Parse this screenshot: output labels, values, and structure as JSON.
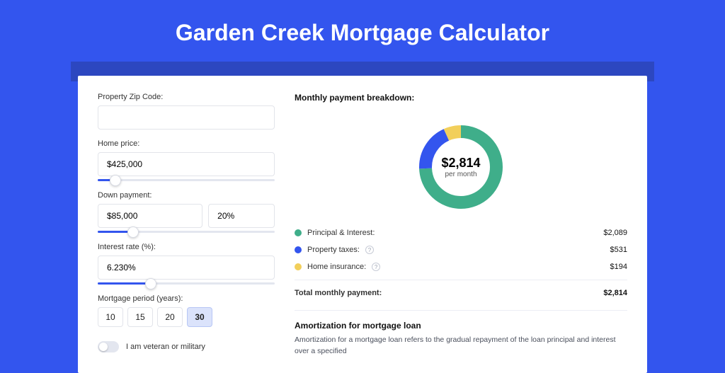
{
  "title": "Garden Creek Mortgage Calculator",
  "form": {
    "zip": {
      "label": "Property Zip Code:",
      "value": ""
    },
    "home_price": {
      "label": "Home price:",
      "value": "$425,000",
      "slider_pct": 10
    },
    "down_pay": {
      "label": "Down payment:",
      "value": "$85,000",
      "pct": "20%",
      "slider_pct": 20
    },
    "rate": {
      "label": "Interest rate (%):",
      "value": "6.230%",
      "slider_pct": 30
    },
    "period": {
      "label": "Mortgage period (years):",
      "options": [
        "10",
        "15",
        "20",
        "30"
      ],
      "active": "30"
    },
    "veteran": {
      "label": "I am veteran or military",
      "on": false
    }
  },
  "breakdown": {
    "title": "Monthly payment breakdown:",
    "center_value": "$2,814",
    "center_label": "per month",
    "items": [
      {
        "name": "Principal & Interest:",
        "amount": "$2,089",
        "color": "#3fae8a",
        "has_info": false
      },
      {
        "name": "Property taxes:",
        "amount": "$531",
        "color": "#3355ee",
        "has_info": true
      },
      {
        "name": "Home insurance:",
        "amount": "$194",
        "color": "#f2cf5b",
        "has_info": true
      }
    ],
    "total_label": "Total monthly payment:",
    "total_amount": "$2,814"
  },
  "amortization": {
    "title": "Amortization for mortgage loan",
    "body": "Amortization for a mortgage loan refers to the gradual repayment of the loan principal and interest over a specified"
  },
  "chart_data": {
    "type": "pie",
    "title": "Monthly payment breakdown",
    "series": [
      {
        "name": "Principal & Interest",
        "value": 2089,
        "color": "#3fae8a"
      },
      {
        "name": "Property taxes",
        "value": 531,
        "color": "#3355ee"
      },
      {
        "name": "Home insurance",
        "value": 194,
        "color": "#f2cf5b"
      }
    ],
    "total": 2814,
    "unit": "USD per month"
  }
}
